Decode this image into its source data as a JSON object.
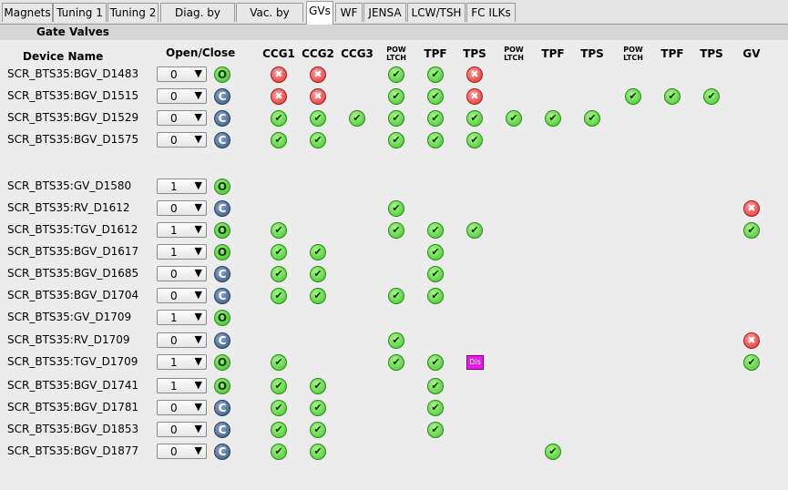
{
  "tabs": [
    "Magnets",
    "Tuning 1",
    "Tuning 2",
    "Diag. by Type",
    "Vac. by Type",
    "GVs",
    "WF",
    "JENSA",
    "LCW/TSH",
    "FC ILKs"
  ],
  "active_tab": "GVs",
  "section_title": "Gate Valves",
  "headers": {
    "device_name": "Device Name",
    "open_close": "Open/Close",
    "cols": [
      "CCG1",
      "CCG2",
      "CCG3",
      "POW LTCH",
      "TPF",
      "TPS",
      "POW LTCH",
      "TPF",
      "TPS",
      "POW LTCH",
      "TPF",
      "TPS",
      "GV"
    ]
  },
  "symbols": {
    "ok": "✔",
    "bad": "✖",
    "dis": "Dis",
    "open": "O",
    "closed": "C",
    "dropdown": "▼"
  },
  "rows": [
    {
      "name": "SCR_BTS35:BGV_D1483",
      "value": "0",
      "state": "O",
      "cells": {
        "CCG1": "bad",
        "CCG2": "bad",
        "POW1": "ok",
        "TPF1": "ok",
        "TPS1": "bad"
      }
    },
    {
      "name": "SCR_BTS35:BGV_D1515",
      "value": "0",
      "state": "C",
      "cells": {
        "CCG1": "bad",
        "CCG2": "bad",
        "POW1": "ok",
        "TPF1": "ok",
        "TPS1": "bad",
        "POW3": "ok",
        "TPF3": "ok",
        "TPS3": "ok"
      }
    },
    {
      "name": "SCR_BTS35:BGV_D1529",
      "value": "0",
      "state": "C",
      "cells": {
        "CCG1": "ok",
        "CCG2": "ok",
        "CCG3": "ok",
        "POW1": "ok",
        "TPF1": "ok",
        "TPS1": "ok",
        "POW2": "ok",
        "TPF2": "ok",
        "TPS2": "ok"
      }
    },
    {
      "name": "SCR_BTS35:BGV_D1575",
      "value": "0",
      "state": "C",
      "cells": {
        "CCG1": "ok",
        "CCG2": "ok",
        "POW1": "ok",
        "TPF1": "ok",
        "TPS1": "ok"
      }
    },
    {
      "name": "SCR_BTS35:GV_D1580",
      "value": "1",
      "state": "O",
      "cells": {}
    },
    {
      "name": "SCR_BTS35:RV_D1612",
      "value": "0",
      "state": "C",
      "cells": {
        "POW1": "ok",
        "GV": "bad"
      }
    },
    {
      "name": "SCR_BTS35:TGV_D1612",
      "value": "1",
      "state": "O",
      "cells": {
        "CCG1": "ok",
        "POW1": "ok",
        "TPF1": "ok",
        "TPS1": "ok",
        "GV": "ok"
      }
    },
    {
      "name": "SCR_BTS35:BGV_D1617",
      "value": "1",
      "state": "O",
      "cells": {
        "CCG1": "ok",
        "CCG2": "ok",
        "TPF1": "ok"
      }
    },
    {
      "name": "SCR_BTS35:BGV_D1685",
      "value": "0",
      "state": "C",
      "cells": {
        "CCG1": "ok",
        "CCG2": "ok",
        "TPF1": "ok"
      }
    },
    {
      "name": "SCR_BTS35:BGV_D1704",
      "value": "0",
      "state": "C",
      "cells": {
        "CCG1": "ok",
        "CCG2": "ok",
        "POW1": "ok",
        "TPF1": "ok"
      }
    },
    {
      "name": "SCR_BTS35:GV_D1709",
      "value": "1",
      "state": "O",
      "cells": {}
    },
    {
      "name": "SCR_BTS35:RV_D1709",
      "value": "0",
      "state": "C",
      "cells": {
        "POW1": "ok",
        "GV": "bad"
      }
    },
    {
      "name": "SCR_BTS35:TGV_D1709",
      "value": "1",
      "state": "O",
      "cells": {
        "CCG1": "ok",
        "POW1": "ok",
        "TPF1": "ok",
        "TPS1": "dis",
        "GV": "ok"
      }
    },
    {
      "name": "SCR_BTS35:BGV_D1741",
      "value": "1",
      "state": "O",
      "cells": {
        "CCG1": "ok",
        "CCG2": "ok",
        "TPF1": "ok"
      }
    },
    {
      "name": "SCR_BTS35:BGV_D1781",
      "value": "0",
      "state": "C",
      "cells": {
        "CCG1": "ok",
        "CCG2": "ok",
        "TPF1": "ok"
      }
    },
    {
      "name": "SCR_BTS35:BGV_D1853",
      "value": "0",
      "state": "C",
      "cells": {
        "CCG1": "ok",
        "CCG2": "ok",
        "TPF1": "ok"
      }
    },
    {
      "name": "SCR_BTS35:BGV_D1877",
      "value": "0",
      "state": "C",
      "cells": {
        "CCG1": "ok",
        "CCG2": "ok",
        "TPF2": "ok"
      }
    }
  ],
  "colors": {
    "ok": "#3ec42a",
    "bad": "#e03030",
    "dis": "#e81ce8",
    "open": "#3fbb28",
    "closed": "#35577f",
    "background": "#ececec"
  }
}
